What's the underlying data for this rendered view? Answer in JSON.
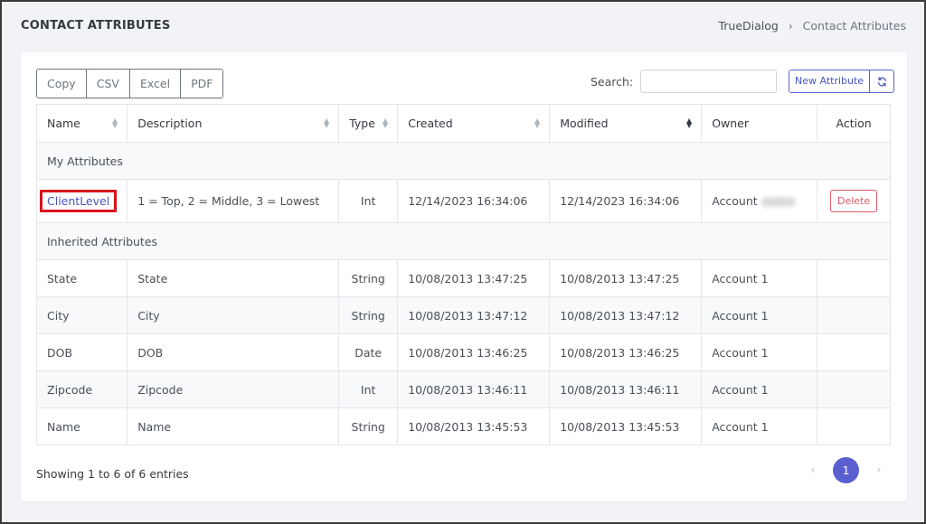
{
  "header": {
    "title": "CONTACT ATTRIBUTES",
    "breadcrumb": [
      "TrueDialog",
      "Contact Attributes"
    ]
  },
  "toolbar": {
    "export_buttons": [
      "Copy",
      "CSV",
      "Excel",
      "PDF"
    ],
    "search_label": "Search:",
    "search_value": "",
    "new_attribute_label": "New Attribute",
    "refresh_icon": "refresh-icon"
  },
  "table": {
    "columns": [
      "Name",
      "Description",
      "Type",
      "Created",
      "Modified",
      "Owner",
      "Action"
    ],
    "groups": {
      "mine": "My Attributes",
      "inherited": "Inherited Attributes"
    },
    "my_rows": [
      {
        "name": "ClientLevel",
        "description": "1 = Top, 2 = Middle, 3 = Lowest",
        "type": "Int",
        "created": "12/14/2023 16:34:06",
        "modified": "12/14/2023 16:34:06",
        "owner": "Account",
        "action": "Delete"
      }
    ],
    "inherited_rows": [
      {
        "name": "State",
        "description": "State",
        "type": "String",
        "created": "10/08/2013 13:47:25",
        "modified": "10/08/2013 13:47:25",
        "owner": "Account 1"
      },
      {
        "name": "City",
        "description": "City",
        "type": "String",
        "created": "10/08/2013 13:47:12",
        "modified": "10/08/2013 13:47:12",
        "owner": "Account 1"
      },
      {
        "name": "DOB",
        "description": "DOB",
        "type": "Date",
        "created": "10/08/2013 13:46:25",
        "modified": "10/08/2013 13:46:25",
        "owner": "Account 1"
      },
      {
        "name": "Zipcode",
        "description": "Zipcode",
        "type": "Int",
        "created": "10/08/2013 13:46:11",
        "modified": "10/08/2013 13:46:11",
        "owner": "Account 1"
      },
      {
        "name": "Name",
        "description": "Name",
        "type": "String",
        "created": "10/08/2013 13:45:53",
        "modified": "10/08/2013 13:45:53",
        "owner": "Account 1"
      }
    ]
  },
  "footer": {
    "info": "Showing 1 to 6 of 6 entries",
    "current_page": "1",
    "prev": "‹",
    "next": "›"
  },
  "colors": {
    "accent": "#5a5fd0",
    "link": "#4a54c0",
    "danger": "#e05a66",
    "highlight": "#d8141b"
  }
}
